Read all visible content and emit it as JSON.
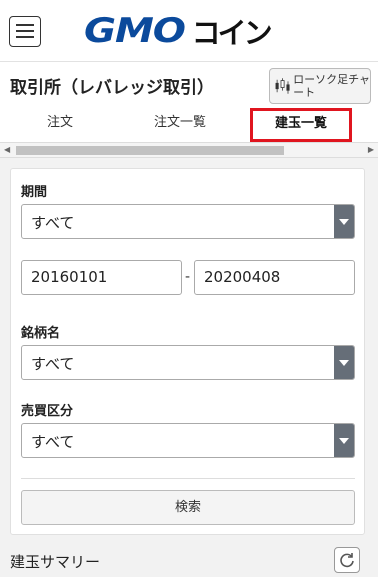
{
  "header": {
    "logo_gmo": "GMO",
    "logo_coin": "コイン",
    "menu_icon": "hamburger-menu-icon"
  },
  "page": {
    "title": "取引所（レバレッジ取引）",
    "candle_button": "ローソク足チャート",
    "candle_icon": "candlestick-chart-icon"
  },
  "tabs": [
    {
      "label": "注文"
    },
    {
      "label": "注文一覧"
    },
    {
      "label": "建玉一覧",
      "active": true
    }
  ],
  "filter": {
    "period_label": "期間",
    "period_value": "すべて",
    "date_from": "20160101",
    "date_separator": "-",
    "date_to": "20200408",
    "symbol_label": "銘柄名",
    "symbol_value": "すべて",
    "side_label": "売買区分",
    "side_value": "すべて",
    "search_button": "検索"
  },
  "summary": {
    "title": "建玉サマリー",
    "refresh_icon": "refresh-icon"
  },
  "colors": {
    "brand_blue": "#0b4a9c",
    "active_tab_border": "#e0151f",
    "select_arrow_bg": "#666e78"
  }
}
